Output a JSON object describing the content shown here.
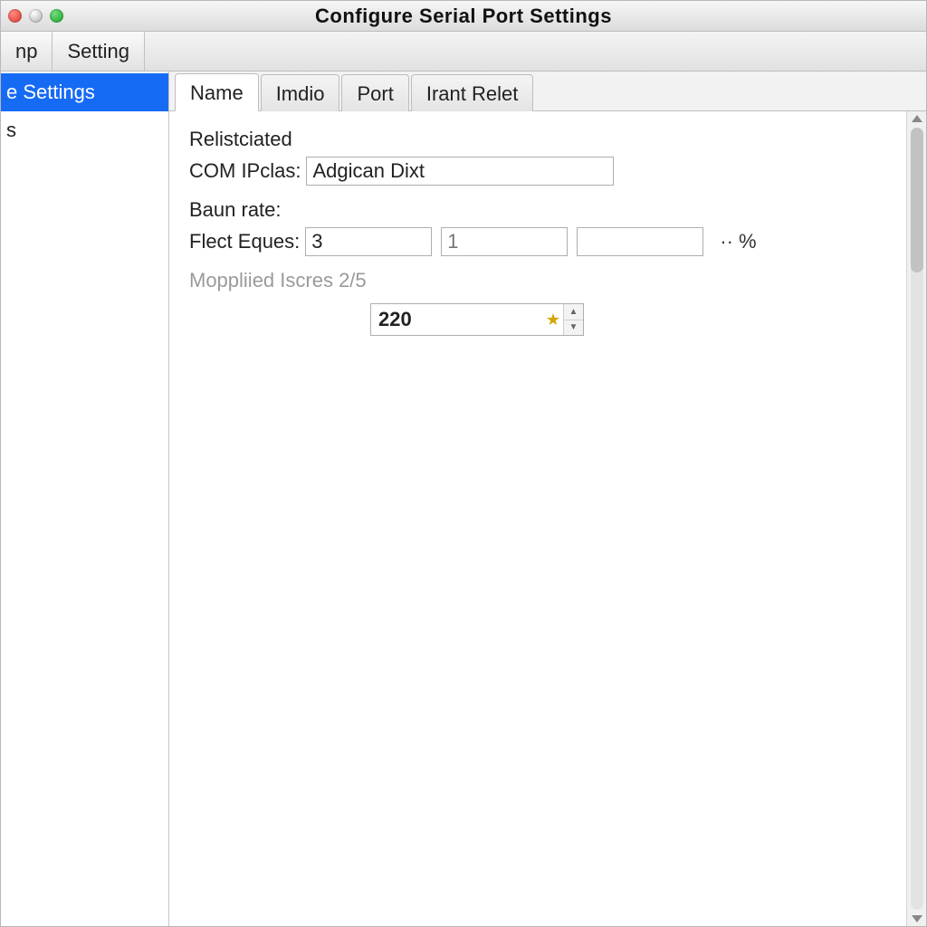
{
  "window": {
    "title": "Configure  Serial  Port   Settings"
  },
  "toolbar": {
    "items": [
      "np",
      "Setting"
    ]
  },
  "sidebar": {
    "items": [
      {
        "label": "e Settings",
        "selected": true
      },
      {
        "label": "s",
        "selected": false
      }
    ]
  },
  "tabs": {
    "items": [
      "Name",
      "Imdio",
      "Port",
      "Irant Relet"
    ],
    "active_index": 0
  },
  "form": {
    "relist_label": "Relistciated",
    "com_label": "COM IPclas:",
    "com_value": "Adgican Dixt",
    "baun_label": "Baun rate:",
    "flect_label": "Flect Eques:",
    "flect_values": {
      "a": "3",
      "b_placeholder": "1",
      "c": ""
    },
    "flect_suffix": "··  %",
    "moppliied_label": "Moppliied Iscres 2/5",
    "spinner_value": "220"
  }
}
